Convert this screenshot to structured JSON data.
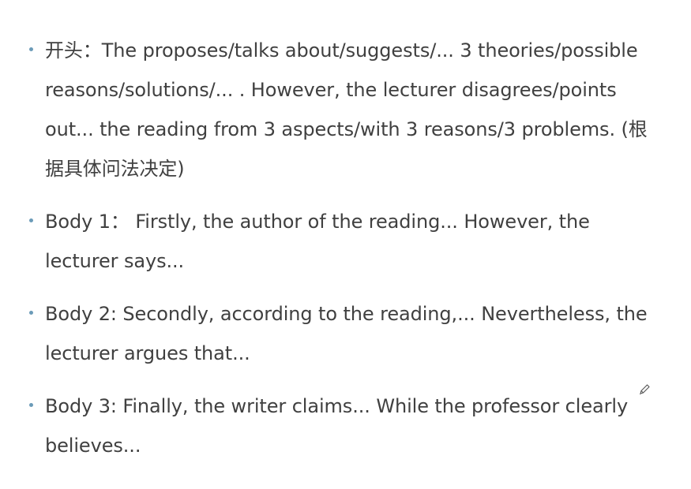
{
  "bullets": [
    {
      "text": "开头：The proposes/talks about/suggests/... 3 theories/possible reasons/solutions/... . However, the lecturer disagrees/points out... the reading from 3 aspects/with 3 reasons/3 problems. (根据具体问法决定)"
    },
    {
      "text": "Body 1： Firstly, the author of the reading... However, the lecturer says..."
    },
    {
      "text": "Body 2: Secondly, according to the reading,... Nevertheless, the lecturer argues that..."
    },
    {
      "text": "Body 3: Finally, the writer claims... While the professor clearly believes..."
    }
  ],
  "icons": {
    "pen": "pencil-icon"
  },
  "colors": {
    "text": "#404040",
    "bullet": "#6b9bb8"
  }
}
